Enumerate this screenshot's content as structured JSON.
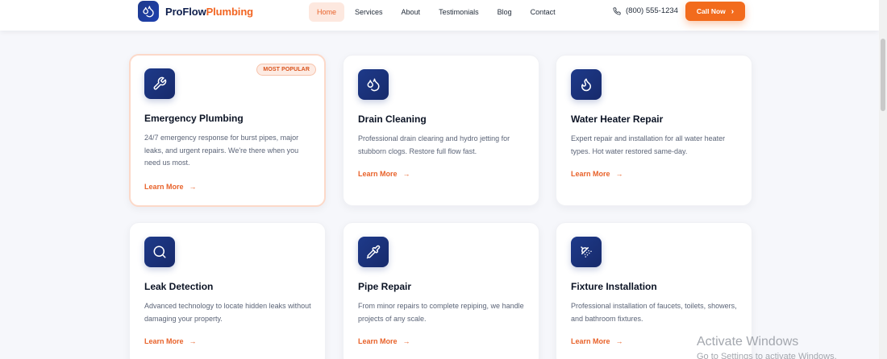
{
  "header": {
    "brand_primary": "ProFlow",
    "brand_accent": "Plumbing",
    "nav": [
      {
        "label": "Home",
        "active": true
      },
      {
        "label": "Services",
        "active": false
      },
      {
        "label": "About",
        "active": false
      },
      {
        "label": "Testimonials",
        "active": false
      },
      {
        "label": "Blog",
        "active": false
      },
      {
        "label": "Contact",
        "active": false
      }
    ],
    "phone": "(800) 555-1234",
    "cta_label": "Call Now",
    "cta_chevron": "›"
  },
  "services": [
    {
      "title": "Emergency Plumbing",
      "description": "24/7 emergency response for burst pipes, major leaks, and urgent repairs. We're there when you need us most.",
      "link": "Learn More",
      "badge": "MOST POPULAR",
      "icon": "wrench-icon"
    },
    {
      "title": "Drain Cleaning",
      "description": "Professional drain clearing and hydro jetting for stubborn clogs. Restore full flow fast.",
      "link": "Learn More",
      "icon": "droplets-icon"
    },
    {
      "title": "Water Heater Repair",
      "description": "Expert repair and installation for all water heater types. Hot water restored same-day.",
      "link": "Learn More",
      "icon": "flame-icon"
    },
    {
      "title": "Leak Detection",
      "description": "Advanced technology to locate hidden leaks without damaging your property.",
      "link": "Learn More",
      "icon": "search-icon"
    },
    {
      "title": "Pipe Repair",
      "description": "From minor repairs to complete repiping, we handle projects of any scale.",
      "link": "Learn More",
      "icon": "pipette-icon"
    },
    {
      "title": "Fixture Installation",
      "description": "Professional installation of faucets, toilets, showers, and bathroom fixtures.",
      "link": "Learn More",
      "icon": "shower-icon"
    }
  ],
  "link_arrow": "→",
  "watermark": {
    "title": "Activate Windows",
    "subtitle": "Go to Settings to activate Windows."
  },
  "colors": {
    "accent": "#f26b1d",
    "navy": "#1e3a8a",
    "background": "#f6f7fb"
  }
}
